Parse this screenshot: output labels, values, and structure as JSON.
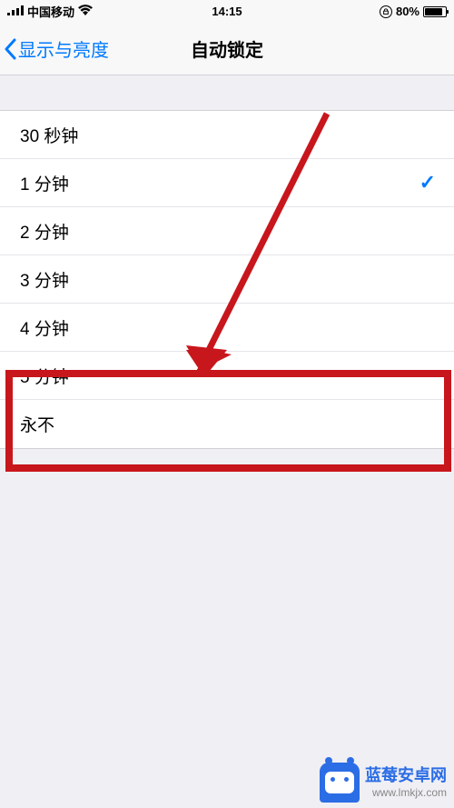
{
  "status_bar": {
    "carrier": "中国移动",
    "time": "14:15",
    "battery_percent": "80%"
  },
  "nav": {
    "back_label": "显示与亮度",
    "title": "自动锁定"
  },
  "options": [
    {
      "label": "30 秒钟",
      "selected": false
    },
    {
      "label": "1 分钟",
      "selected": true
    },
    {
      "label": "2 分钟",
      "selected": false
    },
    {
      "label": "3 分钟",
      "selected": false
    },
    {
      "label": "4 分钟",
      "selected": false
    },
    {
      "label": "5 分钟",
      "selected": false
    },
    {
      "label": "永不",
      "selected": false
    }
  ],
  "watermark": {
    "title": "蓝莓安卓网",
    "url": "www.lmkjx.com"
  },
  "colors": {
    "ios_blue": "#007aff",
    "highlight_red": "#c8161d",
    "brand_blue": "#2b6de5"
  }
}
